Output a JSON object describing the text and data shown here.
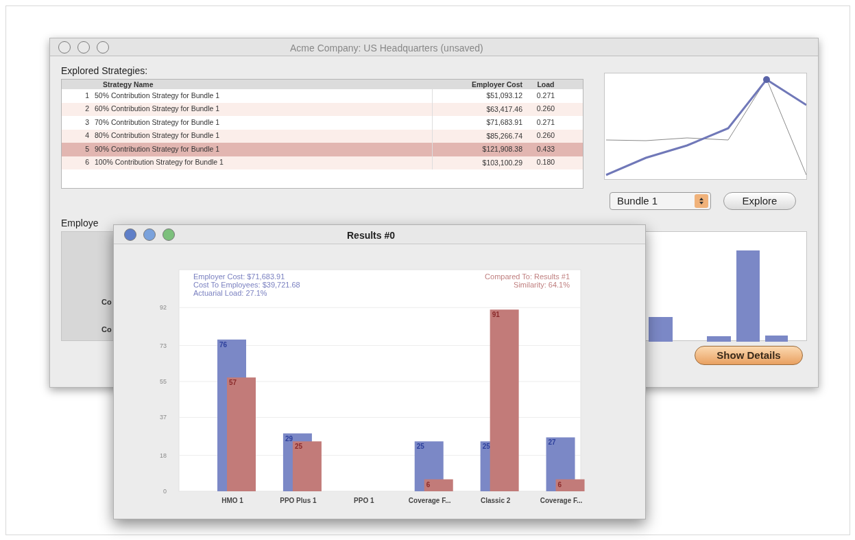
{
  "main_window": {
    "title": "Acme Company: US Headquarters (unsaved)",
    "section_label": "Explored Strategies:",
    "table": {
      "columns": [
        "Strategy Name",
        "Employer Cost",
        "Load"
      ],
      "rows": [
        {
          "index": "1",
          "name": "50% Contribution Strategy for Bundle 1",
          "cost": "$51,093.12",
          "load": "0.271",
          "selected": false
        },
        {
          "index": "2",
          "name": "60% Contribution Strategy for Bundle 1",
          "cost": "$63,417.46",
          "load": "0.260",
          "selected": false
        },
        {
          "index": "3",
          "name": "70% Contribution Strategy for Bundle 1",
          "cost": "$71,683.91",
          "load": "0.271",
          "selected": false
        },
        {
          "index": "4",
          "name": "80% Contribution Strategy for Bundle 1",
          "cost": "$85,266.74",
          "load": "0.260",
          "selected": false
        },
        {
          "index": "5",
          "name": "90% Contribution Strategy for Bundle 1",
          "cost": "$121,908.38",
          "load": "0.433",
          "selected": true
        },
        {
          "index": "6",
          "name": "100% Contribution Strategy for Bundle 1",
          "cost": "$103,100.29",
          "load": "0.180",
          "selected": false
        }
      ]
    },
    "bundle_popup": {
      "value": "Bundle 1"
    },
    "explore_button": "Explore",
    "lower_label": "Employe",
    "lower_row_labels": [
      "Co",
      "Co"
    ],
    "show_details_button": "Show Details"
  },
  "results_window": {
    "title": "Results #0",
    "info_left": [
      "Employer Cost: $71,683.91",
      "Cost To Employees: $39,721.68",
      "Actuarial Load: 27.1%"
    ],
    "info_right": [
      "Compared To: Results #1",
      "Similarity: 64.1%"
    ],
    "chart_data": {
      "type": "bar",
      "categories": [
        "HMO 1",
        "PPO Plus 1",
        "PPO 1",
        "Coverage F...",
        "Classic 2",
        "Coverage F..."
      ],
      "series": [
        {
          "color": "#7b88c6",
          "values": [
            76,
            29,
            null,
            25,
            25,
            27
          ]
        },
        {
          "color": "#c27b79",
          "values": [
            57,
            25,
            null,
            6,
            91,
            6
          ]
        }
      ],
      "ylim": [
        0,
        111
      ],
      "grid": true,
      "yticks": [
        0,
        18,
        37,
        55,
        73,
        92
      ],
      "data_labels": true
    }
  }
}
